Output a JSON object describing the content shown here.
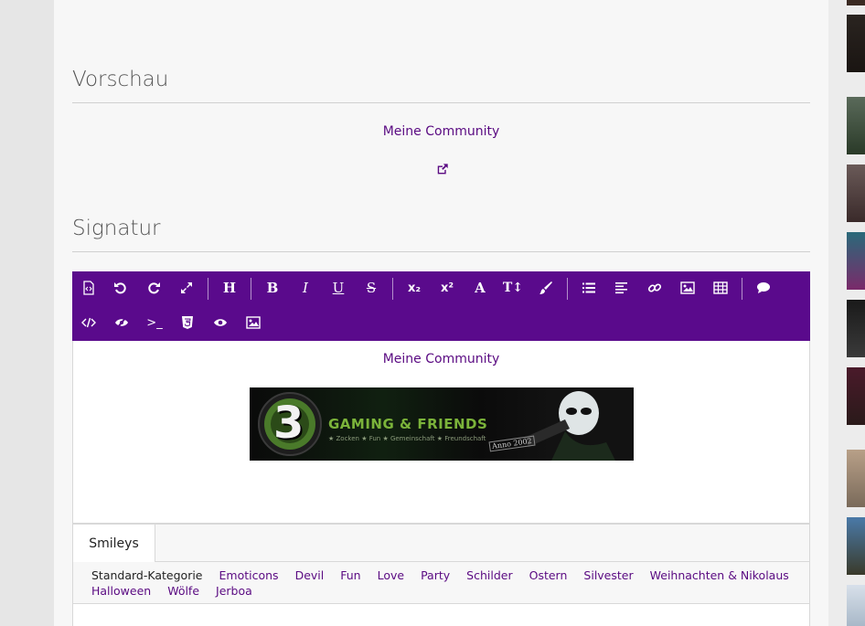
{
  "preview": {
    "title": "Vorschau",
    "link_text": "Meine Community",
    "external_icon": "external-link-icon"
  },
  "signature": {
    "title": "Signatur"
  },
  "toolbar": {
    "buttons": [
      "source-icon",
      "undo-icon",
      "redo-icon",
      "fullscreen-icon",
      "heading-icon",
      "bold-icon",
      "italic-icon",
      "underline-icon",
      "strikethrough-icon",
      "subscript-icon",
      "superscript-icon",
      "font-family-icon",
      "font-size-icon",
      "text-color-icon",
      "list-icon",
      "align-icon",
      "link-icon",
      "image-icon",
      "table-icon",
      "quote-icon",
      "code-icon",
      "spoiler-icon",
      "inline-code-icon",
      "html-icon",
      "preview-icon",
      "media-icon"
    ],
    "labels": {
      "heading": "H",
      "bold": "B",
      "italic": "I",
      "underline": "U",
      "strike": "S",
      "sub": "x₂",
      "sup": "x²",
      "font": "A",
      "size": "T↕",
      "tt": ">_"
    }
  },
  "editor": {
    "link_text": "Meine Community",
    "banner": {
      "number": "3",
      "headline": "GAMING & FRIENDS",
      "tagline": "★ Zocken  ★ Fun  ★ Gemeinschaft  ★ Freundschaft",
      "since": "Anno 2002"
    }
  },
  "smileys": {
    "tab_label": "Smileys",
    "categories_row1": [
      "Standard-Kategorie",
      "Emoticons",
      "Devil",
      "Fun",
      "Love",
      "Party",
      "Schilder",
      "Ostern",
      "Silvester",
      "Weihnachten & Nikolaus"
    ],
    "categories_row2": [
      "Halloween",
      "Wölfe",
      "Jerboa"
    ]
  },
  "colors": {
    "accent": "#5a0a8c",
    "link": "#5a0a82"
  }
}
